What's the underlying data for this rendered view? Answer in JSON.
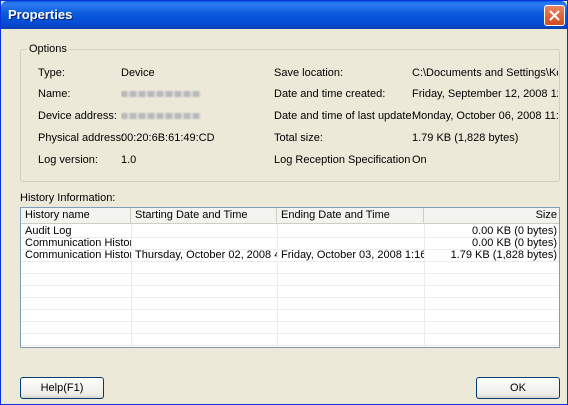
{
  "window": {
    "title": "Properties"
  },
  "options": {
    "legend": "Options",
    "left": [
      {
        "label": "Type:",
        "value": "Device"
      },
      {
        "label": "Name:",
        "value": "",
        "redacted": true
      },
      {
        "label": "Device address:",
        "value": "",
        "redacted": true
      },
      {
        "label": "Physical address:",
        "value": "00:20:6B:61:49:CD"
      },
      {
        "label": "Log version:",
        "value": "1.0"
      }
    ],
    "right": [
      {
        "label": "Save location:",
        "value": "C:\\Documents and Settings\\Ko"
      },
      {
        "label": "Date and time created:",
        "value": "Friday, September 12, 2008 12:"
      },
      {
        "label": "Date and time of last update:",
        "value": "Monday, October 06, 2008 11:0"
      },
      {
        "label": "Total size:",
        "value": "1.79 KB (1,828 bytes)"
      },
      {
        "label": "Log Reception Specification",
        "value": "On"
      }
    ]
  },
  "history": {
    "label": "History Information:",
    "columns": [
      "History name",
      "Starting Date and Time",
      "Ending Date and Time",
      "Size"
    ],
    "rows": [
      [
        "Audit Log",
        "",
        "",
        "0.00 KB (0 bytes)"
      ],
      [
        "Communication Histor...",
        "",
        "",
        "0.00 KB (0 bytes)"
      ],
      [
        "Communication Histor...",
        "Thursday, October 02, 2008 4...",
        "Friday, October 03, 2008 1:16...",
        "1.79 KB (1,828 bytes)"
      ]
    ]
  },
  "buttons": {
    "help": "Help(F1)",
    "ok": "OK"
  }
}
